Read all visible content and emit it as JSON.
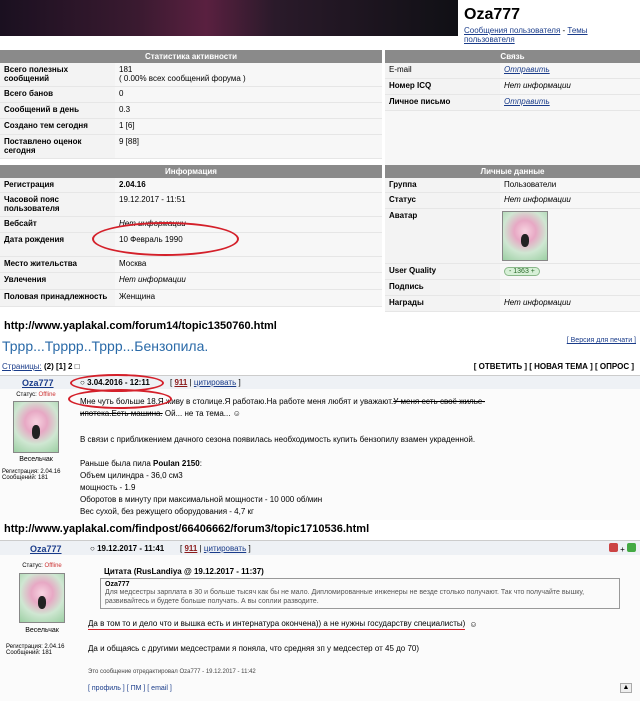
{
  "profile": {
    "username": "Oza777",
    "links": {
      "messages": "Сообщения пользователя",
      "sep": " - ",
      "topics": "Темы пользователя"
    },
    "stats_header": "Статистика активности",
    "stats": [
      {
        "label": "Всего полезных сообщений",
        "value": "181",
        "sub": "( 0.00% всех сообщений форума )"
      },
      {
        "label": "Всего банов",
        "value": "0"
      },
      {
        "label": "Сообщений в день",
        "value": "0.3"
      },
      {
        "label": "Создано тем сегодня",
        "value": "1 [6]"
      },
      {
        "label": "Поставлено оценок сегодня",
        "value": "9 [88]"
      }
    ],
    "contact_header": "Связь",
    "contacts": [
      {
        "label": "E-mail",
        "value": "Отправить"
      },
      {
        "label": "Номер ICQ",
        "value": "Нет информации"
      },
      {
        "label": "Личное письмо",
        "value": "Отправить"
      }
    ],
    "info_header": "Информация",
    "info": [
      {
        "label": "Регистрация",
        "value": "2.04.16"
      },
      {
        "label": "Часовой пояс пользователя",
        "value": "19.12.2017 - 11:51"
      },
      {
        "label": "Вебсайт",
        "value": "Нет информации"
      },
      {
        "label": "Дата рождения",
        "value": "10 Февраль 1990"
      },
      {
        "label": "Место жительства",
        "value": "Москва"
      },
      {
        "label": "Увлечения",
        "value": "Нет информации"
      },
      {
        "label": "Половая принадлежность",
        "value": "Женщина"
      }
    ],
    "personal_header": "Личные данные",
    "personal": [
      {
        "label": "Группа",
        "value": "Пользователи"
      },
      {
        "label": "Статус",
        "value": "Нет информации"
      },
      {
        "label": "Аватар",
        "value": ""
      },
      {
        "label": "User Quality",
        "value": "- 1363 +"
      },
      {
        "label": "Подпись",
        "value": ""
      },
      {
        "label": "Награды",
        "value": "Нет информации"
      }
    ]
  },
  "url1": "http://www.yaplakal.com/forum14/topic1350760.html",
  "thread1": {
    "print_version": "[ Версия для печати ]",
    "title": "Тррр...Трррр..Тррр...Бензопила.",
    "pages_label": "Страницы:",
    "pages_value": "(2) [1] 2",
    "actions": "[ ОТВЕТИТЬ ] [ НОВАЯ ТЕМА ] [ ОПРОС ]",
    "author": "Oza777",
    "date": "3.04.2016 - 12:11",
    "score": "911",
    "quote_btn": "цитировать",
    "status_label": "Статус: ",
    "status": "Offline",
    "rank": "Весельчак",
    "reg": "Регистрация: 2.04.16",
    "posts_count": "Сообщений: 181",
    "line1a": "Мне чуть больше 18.Я живу в столице.Я работаю.На работе меня любят и уважают.",
    "line1b": "У меня есть своё жилье-",
    "line2a": "ипотека.Есть машина.",
    "line2b": " Ой... не та тема...",
    "para2": "В связи с приближением дачного сезона появилась необходимость купить бензопилу взамен украденной.",
    "para3_pre": "Раньше была пила ",
    "para3_bold": "Poulan 2150",
    "para3_post": ":",
    "specs": [
      "Объем цилиндра - 36,0 см3",
      "мощность - 1.9",
      "Оборотов в минуту при максимальной мощности - 10 000 об/мин",
      "Вес сухой, без режущего оборудования - 4,7 кг"
    ]
  },
  "url2": "http://www.yaplakal.com/findpost/66406662/forum3/topic1710536.html",
  "thread2": {
    "author": "Oza777",
    "date": "19.12.2017 - 11:41",
    "score": "911",
    "quote_btn": "цитировать",
    "status_label": "Статус: ",
    "status": "Offline",
    "rank": "Весельчак",
    "reg": "Регистрация: 2.04.16",
    "posts_count": "Сообщений: 181",
    "quote_head": "Цитата (RusLandiya @ 19.12.2017 - 11:37)",
    "quote_author": "Oza777",
    "quote_body": "Для медсестры зарплата в 30 и больше тысяч как бы не мало. Дипломированные инженеры не везде столько получают.  Так что получайте вышку, развивайтесь и будете больше получать. А вы соплии разводите.",
    "reply1": "Да в том то и дело что и вышка есть и интернатура окончена)) а не нужны государству специалисты)",
    "reply2": "Да и общаясь с другими медсестрами я поняла, что средняя зп у медсестер от 45 до 70)",
    "edited": "Это сообщение отредактировал Oza777 - 19.12.2017 - 11:42",
    "footer": "[ профиль ] [ ПМ ] [ email ]"
  },
  "colors": {
    "accent": "#d4202a",
    "header_gray": "#8a8a8a",
    "link": "#1a3c8a"
  }
}
